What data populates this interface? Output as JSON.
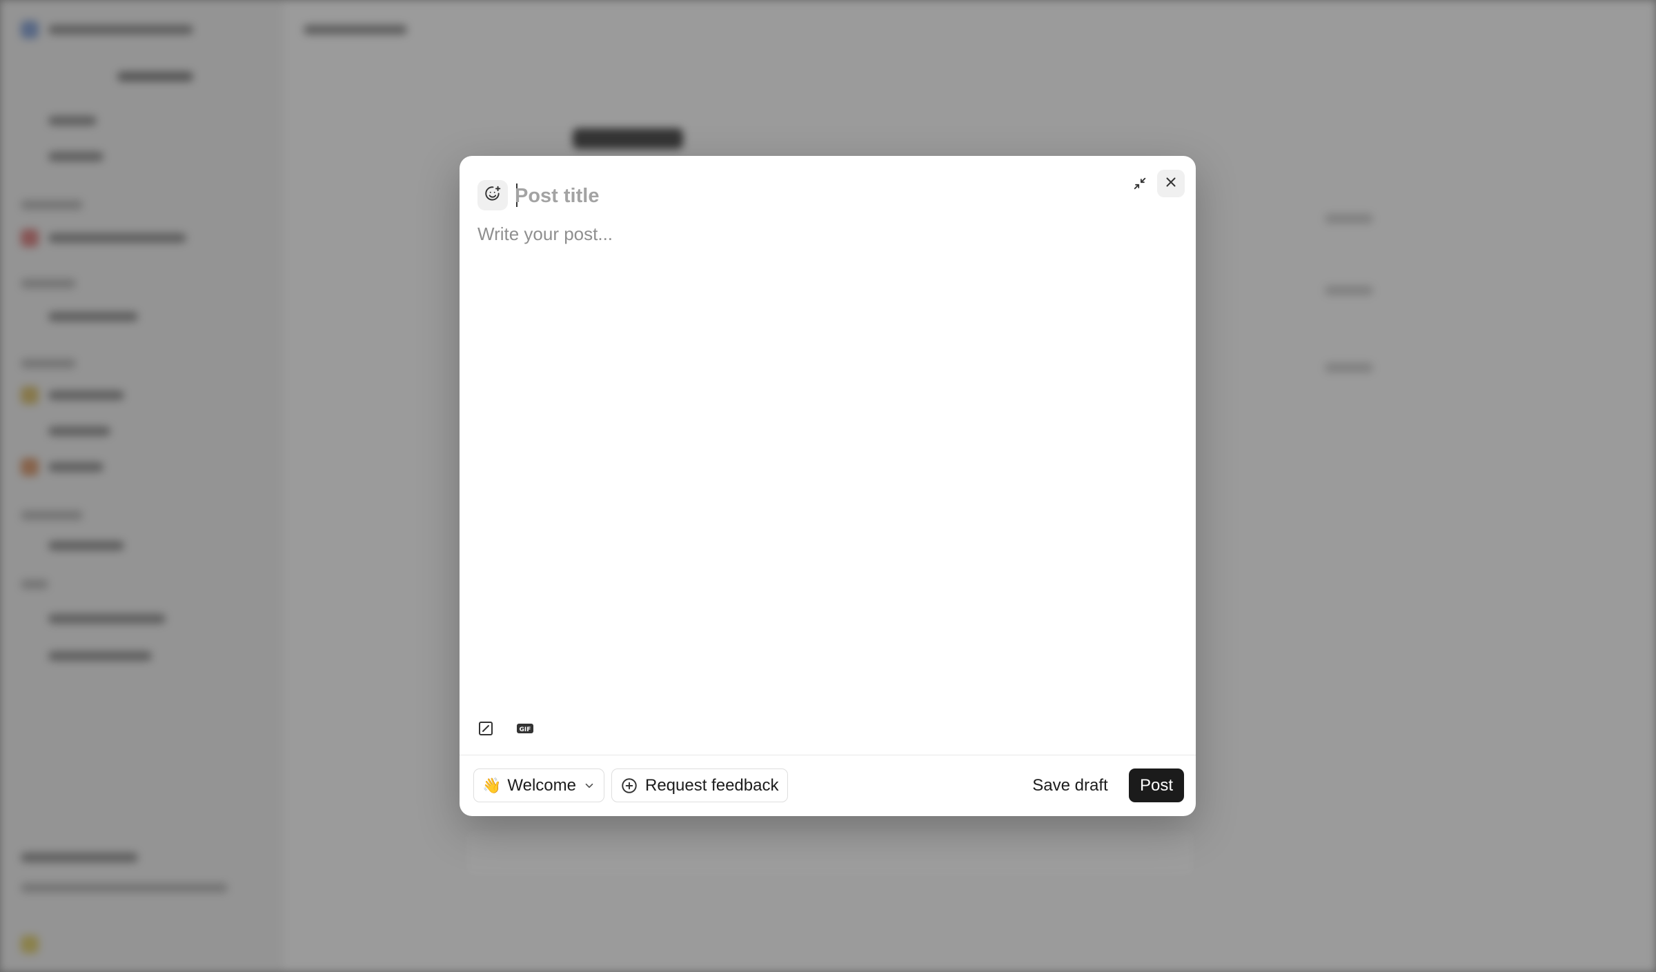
{
  "composer": {
    "title_placeholder": "Post title",
    "body_placeholder": "Write your post...",
    "tag": {
      "emoji": "👋",
      "label": "Welcome"
    },
    "request_feedback_label": "Request feedback",
    "save_draft_label": "Save draft",
    "post_label": "Post"
  },
  "icons": {
    "emoji_picker": "add-emoji-icon",
    "minimize": "minimize-icon",
    "close": "close-icon",
    "media": "image-upload-icon",
    "gif": "gif-icon",
    "chevron": "chevron-down-icon",
    "plus_circle": "plus-circle-icon"
  },
  "colors": {
    "post_button_bg": "#1b1b1b",
    "placeholder": "#a3a3a3",
    "overlay": "#a3a3a3"
  }
}
